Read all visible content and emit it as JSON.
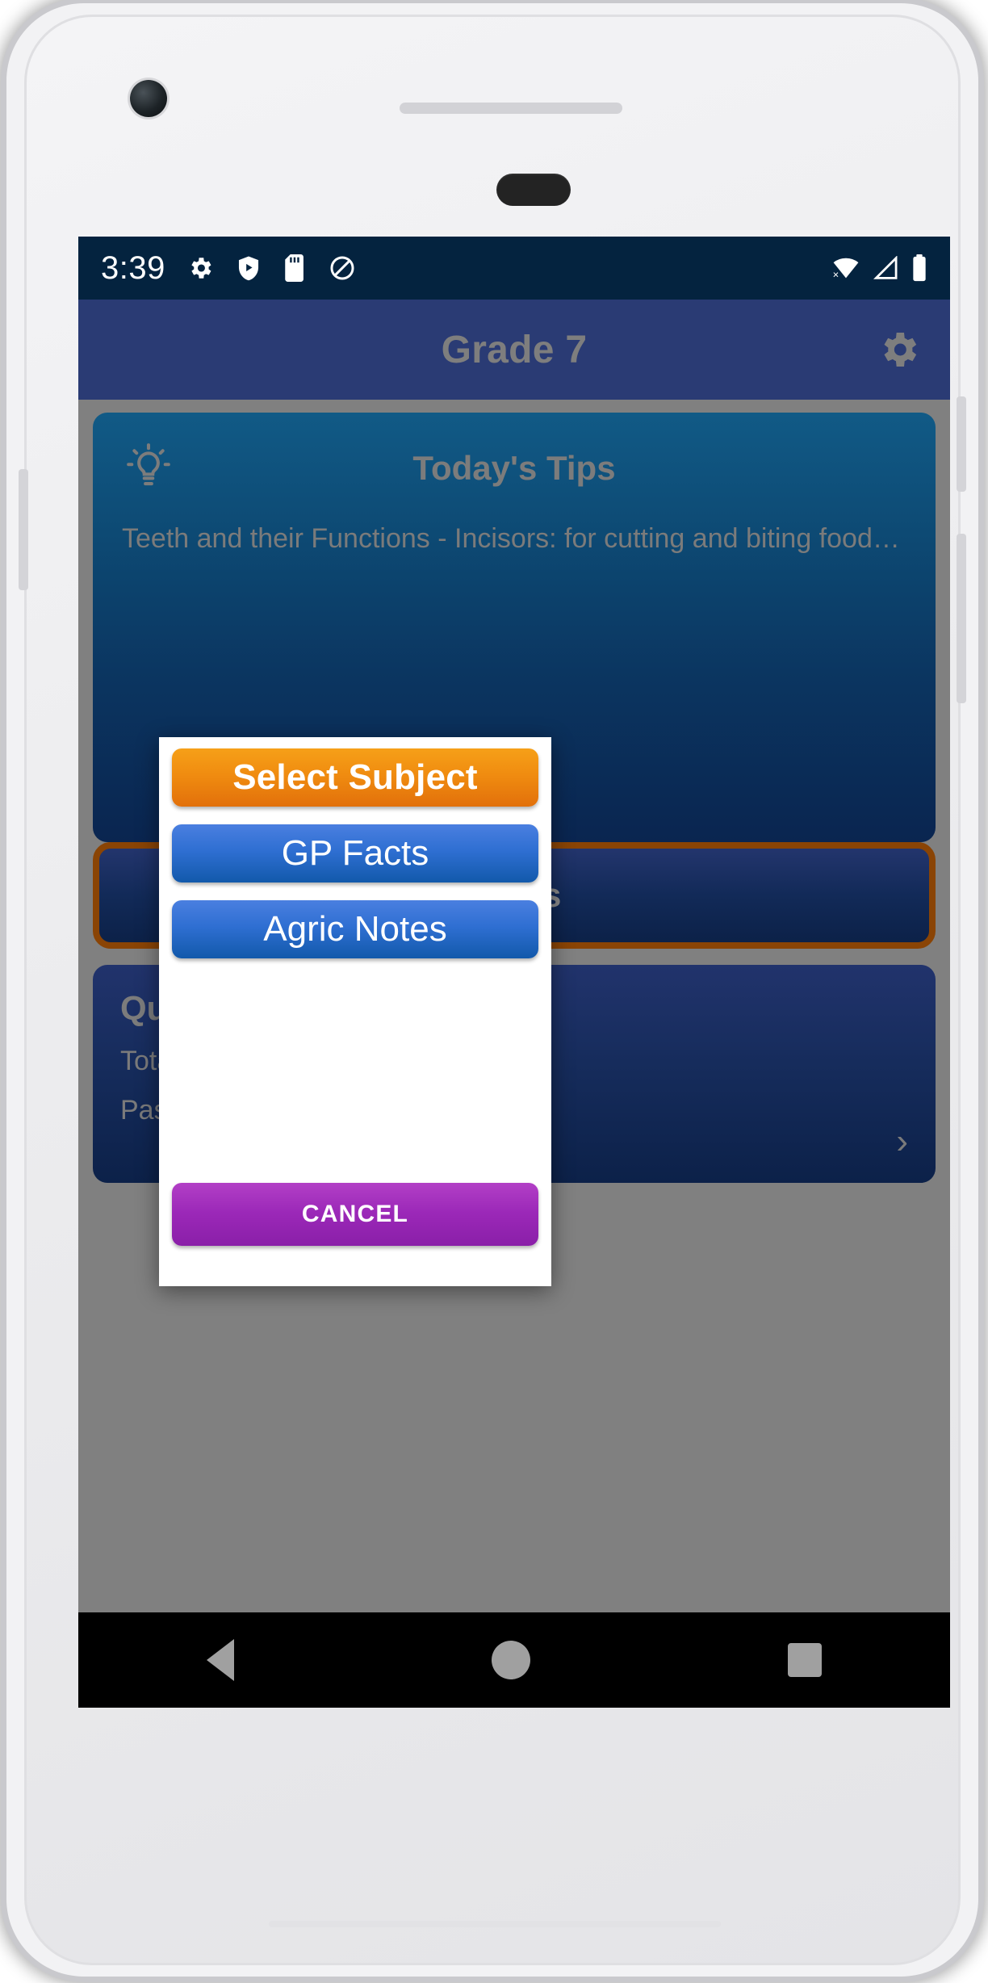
{
  "status_bar": {
    "time": "3:39",
    "left_icons": [
      "gear-icon",
      "shield-play-icon",
      "sd-card-icon",
      "do-not-disturb-icon"
    ],
    "right_icons": [
      "wifi-off-icon",
      "signal-icon",
      "battery-icon"
    ],
    "background_color": "#04233f"
  },
  "app_bar": {
    "title": "Grade 7",
    "settings_icon": "gear-icon",
    "background_color": "#2a3b74"
  },
  "tips_card": {
    "icon": "lightbulb-icon",
    "title": "Today's Tips",
    "body": "Teeth and their Functions\n- Incisors: for cutting and biting food…"
  },
  "notes_button": {
    "label": "Notes",
    "border_color": "#8a4405"
  },
  "quiz_card": {
    "title": "Quiz",
    "lines": [
      "Total Attempts",
      "Passed"
    ],
    "chevron": "›"
  },
  "dialog": {
    "title": "Select Subject",
    "options": [
      {
        "label": "GP Facts"
      },
      {
        "label": "Agric Notes"
      }
    ],
    "cancel_label": "CANCEL",
    "title_color": "#ef8a10",
    "option_color": "#2f6fd2",
    "cancel_color": "#9b28b8"
  },
  "nav_bar": {
    "back": "back-triangle-icon",
    "home": "home-circle-icon",
    "recents": "recents-square-icon"
  }
}
